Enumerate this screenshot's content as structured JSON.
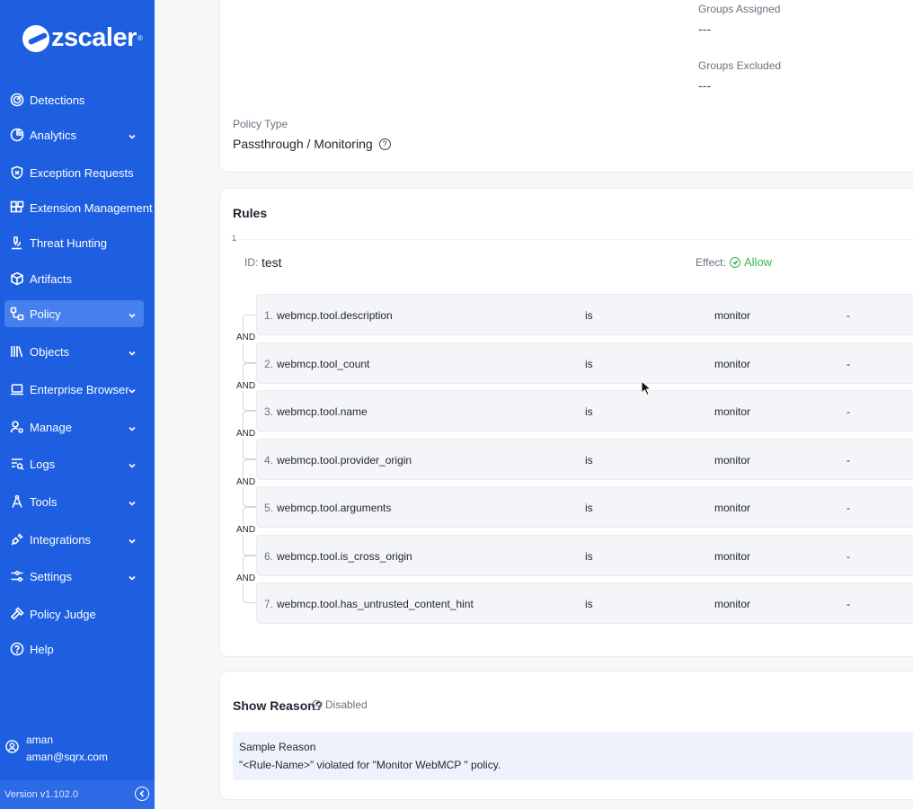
{
  "brand": {
    "name": "zscaler",
    "tm": "®"
  },
  "sidebar": {
    "items": [
      {
        "label": "Detections",
        "icon": "radar-icon",
        "chevron": false,
        "active": false
      },
      {
        "label": "Analytics",
        "icon": "pie-chart-icon",
        "chevron": true,
        "active": false
      },
      {
        "label": "Exception Requests",
        "icon": "shield-x-icon",
        "chevron": false,
        "active": false
      },
      {
        "label": "Extension Management",
        "icon": "blocks-icon",
        "chevron": false,
        "active": false
      },
      {
        "label": "Threat Hunting",
        "icon": "microscope-icon",
        "chevron": false,
        "active": false
      },
      {
        "label": "Artifacts",
        "icon": "package-icon",
        "chevron": false,
        "active": false
      },
      {
        "label": "Policy",
        "icon": "workflow-icon",
        "chevron": true,
        "active": true
      },
      {
        "label": "Objects",
        "icon": "library-icon",
        "chevron": true,
        "active": false
      },
      {
        "label": "Enterprise Browser",
        "icon": "laptop-icon",
        "chevron": true,
        "active": false
      },
      {
        "label": "Manage",
        "icon": "user-cog-icon",
        "chevron": true,
        "active": false
      },
      {
        "label": "Logs",
        "icon": "log-search-icon",
        "chevron": true,
        "active": false
      },
      {
        "label": "Tools",
        "icon": "compass-tool-icon",
        "chevron": true,
        "active": false
      },
      {
        "label": "Integrations",
        "icon": "plug-icon",
        "chevron": true,
        "active": false
      },
      {
        "label": "Settings",
        "icon": "sliders-icon",
        "chevron": true,
        "active": false
      },
      {
        "label": "Policy Judge",
        "icon": "gavel-icon",
        "chevron": false,
        "active": false
      },
      {
        "label": "Help",
        "icon": "help-circle-icon",
        "chevron": false,
        "active": false
      }
    ],
    "user": {
      "name": "aman",
      "email": "aman@sqrx.com"
    },
    "version": "Version  v1.102.0"
  },
  "details": {
    "groups_assigned_label": "Groups Assigned",
    "groups_assigned_value": "---",
    "groups_excluded_label": "Groups Excluded",
    "groups_excluded_value": "---",
    "policy_type_label": "Policy Type",
    "policy_type_value": "Passthrough / Monitoring"
  },
  "rules": {
    "title": "Rules",
    "rule_number": "1",
    "id_label": "ID:",
    "id_value": "test",
    "effect_label": "Effect:",
    "effect_value": "Allow",
    "connector": "AND",
    "conditions": [
      {
        "num": "1.",
        "field": "webmcp.tool.description",
        "op": "is",
        "value": "monitor",
        "extra": "-"
      },
      {
        "num": "2.",
        "field": "webmcp.tool_count",
        "op": "is",
        "value": "monitor",
        "extra": "-"
      },
      {
        "num": "3.",
        "field": "webmcp.tool.name",
        "op": "is",
        "value": "monitor",
        "extra": "-"
      },
      {
        "num": "4.",
        "field": "webmcp.tool.provider_origin",
        "op": "is",
        "value": "monitor",
        "extra": "-"
      },
      {
        "num": "5.",
        "field": "webmcp.tool.arguments",
        "op": "is",
        "value": "monitor",
        "extra": "-"
      },
      {
        "num": "6.",
        "field": "webmcp.tool.is_cross_origin",
        "op": "is",
        "value": "monitor",
        "extra": "-"
      },
      {
        "num": "7.",
        "field": "webmcp.tool.has_untrusted_content_hint",
        "op": "is",
        "value": "monitor",
        "extra": "-"
      }
    ]
  },
  "reason": {
    "title": "Show Reason?",
    "status": "Disabled",
    "sample_title": "Sample Reason",
    "sample_text": "\"<Rule-Name>\" violated for \"Monitor WebMCP \" policy."
  },
  "colors": {
    "sidebar": "#1d5fe0",
    "active": "#4680ec",
    "allow": "#3bb54a"
  }
}
